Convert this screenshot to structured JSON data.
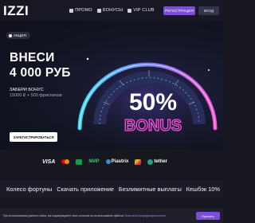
{
  "header": {
    "logo": "IZZI",
    "nav": [
      {
        "label": "ПРОМО",
        "icon": "gift-icon"
      },
      {
        "label": "БОНУСЫ",
        "icon": "bonus-icon"
      },
      {
        "label": "VIP CLUB",
        "icon": "crown-icon"
      }
    ],
    "register_label": "РЕГИСТРАЦИЯ",
    "login_label": "ВХОД"
  },
  "hero": {
    "badge": "АКЦИЯ",
    "title_line1": "ВНЕСИ",
    "title_line2": "4 000 РУБ",
    "subtitle": "ЗАБЕРИ БОНУС",
    "subtitle_detail": "15000 ₽ + 500 фриспинов",
    "cta_label": "ЗАРЕГИСТРИРОВАТЬСЯ",
    "art_percent": "50%",
    "art_word": "BONUS",
    "colors": {
      "accent": "#7a4fd6",
      "neon_cyan": "#3be3ff",
      "neon_pink": "#ff4fd8"
    }
  },
  "payments": [
    {
      "label": "VISA",
      "icon": "visa-icon"
    },
    {
      "label": "",
      "icon": "mastercard-icon"
    },
    {
      "label": "",
      "icon": "mir-icon"
    },
    {
      "label": "МИР",
      "icon": "mir-logo"
    },
    {
      "label": "Piastrix",
      "icon": "piastrix-icon"
    },
    {
      "label": "",
      "icon": "sbp-icon"
    },
    {
      "label": "tether",
      "icon": "tether-icon"
    }
  ],
  "features": [
    "Колесо фортуны",
    "Скачать приложение",
    "Безлимитные выплаты",
    "Кешбэк 10%"
  ],
  "cookie": {
    "text": "При использовании данного сайта, вы подтверждаете свое согласие на использование файлов",
    "link": "Политикой конфиденциальности",
    "button": "Принять"
  }
}
